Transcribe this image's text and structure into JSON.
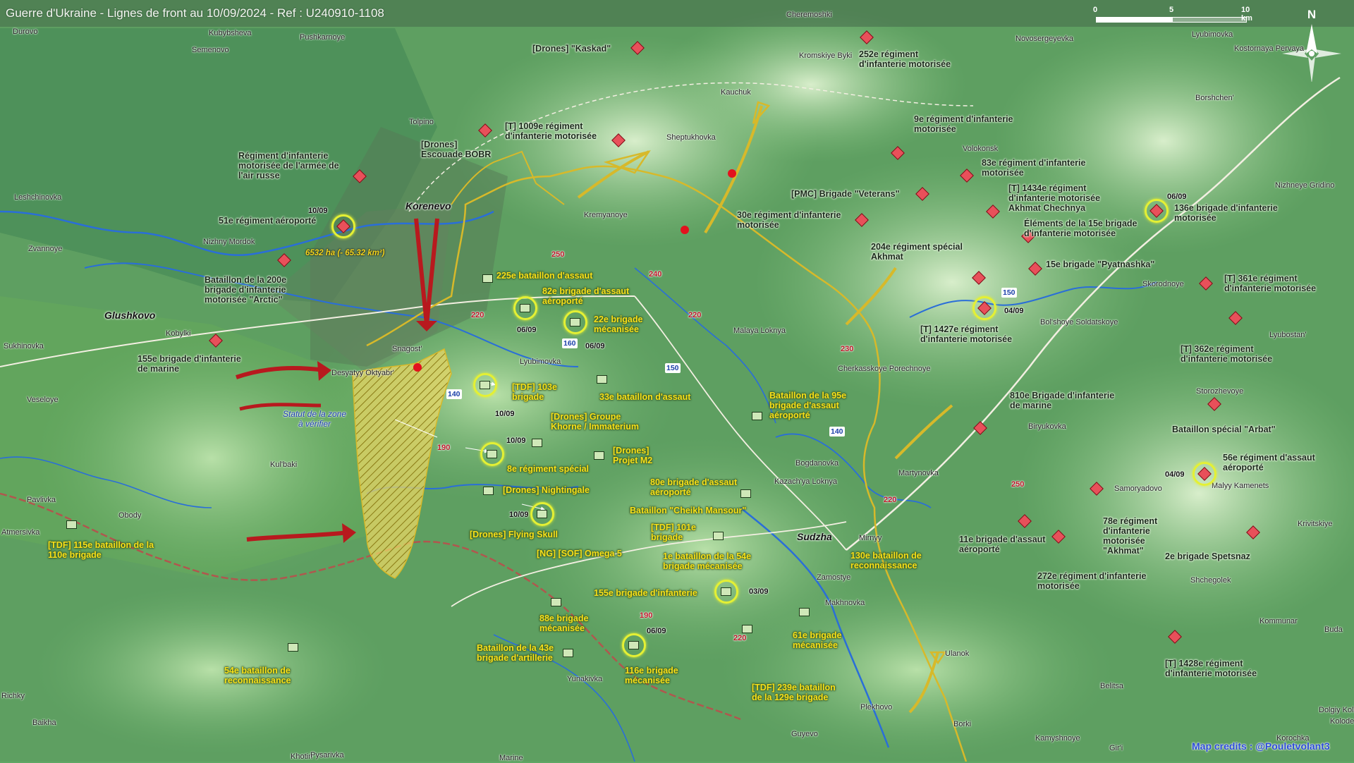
{
  "header": {
    "title": "Guerre d'Ukraine - Lignes de front au 10/09/2024 - Ref : U240910-1108"
  },
  "scale": {
    "ticks": [
      "0",
      "5",
      "10 km"
    ]
  },
  "compass": {
    "label": "N"
  },
  "credits": "Map credits : @Pouletvolant3",
  "map": {
    "towns": [
      "Durovo",
      "Kubybsheva",
      "Pushkarnoye",
      "Cheremoshki",
      "Novosergeyevka",
      "Lyubimovka",
      "Kostornaya Pervaya",
      "Semenovo",
      "Kromskiye Byki",
      "Kauchuk",
      "Borshchen'",
      "Tolpino",
      "Sheptukhovka",
      "Volokonsk",
      "Nizhneye Gridino",
      "Leshchinovka",
      "Kremyanoye",
      "Zvannoye",
      "Nizhny Mordok",
      "Skorodnoye",
      "Kobylki",
      "Sukhinovka",
      "Snagost'",
      "Desyatyy Oktyabr'",
      "Lyubimovka",
      "Malaya Loknya",
      "Bol'shoye Soldatskoye",
      "Lyubostan'",
      "Veseloye",
      "Cherkasskoye Porechnoye",
      "Storozhevoye",
      "Biryukovka",
      "Kul'baki",
      "Bogdanovka",
      "Pavlivka",
      "Obody",
      "Kazach'ya Loknya",
      "Martynovka",
      "Samoryadovo",
      "Malyy Kamenets",
      "Mirnyy",
      "Krivitskiye",
      "Zamostye",
      "Makhnovka",
      "Shchegolek",
      "Kommunar",
      "Yunakivka",
      "Ulanok",
      "Kolodezi",
      "Belitsa",
      "Plekhovo",
      "Borki",
      "Guyevo",
      "Khotin",
      "Pysarivka",
      "Marine",
      "Kamyshnoye",
      "Gir'i",
      "Korochka",
      "Baikha",
      "Richky",
      "Atmersivka",
      "Buda",
      "Dolgiy Kolodezi"
    ],
    "towns_big": [
      "Korenevo",
      "Glushkovo",
      "Sudzha"
    ],
    "elevations": [
      "250",
      "240",
      "220",
      "220",
      "230",
      "250",
      "220",
      "220",
      "190"
    ],
    "roads": [
      "160",
      "150",
      "150",
      "140",
      "140"
    ],
    "area_label": "6532 ha (- 65.32 km²)",
    "status_label": "Statut de la zone à vérifier",
    "dates": [
      "10/09",
      "06/09",
      "06/09",
      "10/09",
      "10/09",
      "10/09",
      "03/09",
      "06/09",
      "06/09",
      "04/09",
      "04/09"
    ],
    "units_ru": [
      "[Drones] \"Kaskad\"",
      "[T] 1009e régiment d'infanterie motorisée",
      "[Drones] Escouade BOBR",
      "Régiment d'infanterie motorisée de l'armée de l'air russe",
      "51e régiment aéroporté",
      "Bataillon de la 200e brigade d'infanterie motorisée \"Arctic\"",
      "155e brigade d'infanterie de marine",
      "252e régiment d'infanterie motorisée",
      "9e régiment d'infanterie motorisée",
      "83e régiment d'infanterie motorisée",
      "[PMC] Brigade \"Veterans\"",
      "[T] 1434e régiment d'infanterie motorisée Akhmat Chechnya",
      "Éléments de la 15e brigade d'infanterie motorisée",
      "136e brigade d'infanterie motorisée",
      "30e régiment d'infanterie motorisée",
      "204e régiment spécial Akhmat",
      "15e brigade \"Pyatnashka\"",
      "[T] 361e régiment d'infanterie motorisée",
      "[T] 1427e régiment d'infanterie motorisée",
      "[T] 362e régiment d'infanterie motorisée",
      "810e Brigade d'infanterie de marine",
      "Bataillon spécial \"Arbat\"",
      "56e régiment d'assaut aéroporté",
      "11e brigade d'assaut aéroporté",
      "78e régiment d'infanterie motorisée \"Akhmat\"",
      "2e brigade Spetsnaz",
      "272e régiment d'infanterie motorisée",
      "[T] 1428e régiment d'infanterie motorisée"
    ],
    "units_ua": [
      "225e bataillon d'assaut",
      "82e brigade d'assaut aéroporté",
      "22e brigade mécanisée",
      "[TDF] 103e brigade",
      "33e bataillon d'assaut",
      "[Drones] Groupe Khorne / Immaterium",
      "[Drones] Projet M2",
      "8e régiment spécial",
      "[Drones] Nightingale",
      "[Drones] Flying Skull",
      "80e brigade d'assaut aéroporté",
      "Bataillon \"Cheikh Mansour\"",
      "[TDF] 101e brigade",
      "[NG] [SOF] Omega 5",
      "1e bataillon de la 54e brigade mécanisée",
      "130e bataillon de reconnaissance",
      "155e brigade d'infanterie",
      "88e brigade mécanisée",
      "Bataillon de la 95e brigade d'assaut aéroporté",
      "Bataillon de la 43e brigade d'artillerie",
      "116e brigade mécanisée",
      "61e brigade mécanisée",
      "[TDF] 239e bataillon de la 129e brigade",
      "[TDF] 115e bataillon de la 110e brigade",
      "54e bataillon de reconnaissance"
    ]
  }
}
